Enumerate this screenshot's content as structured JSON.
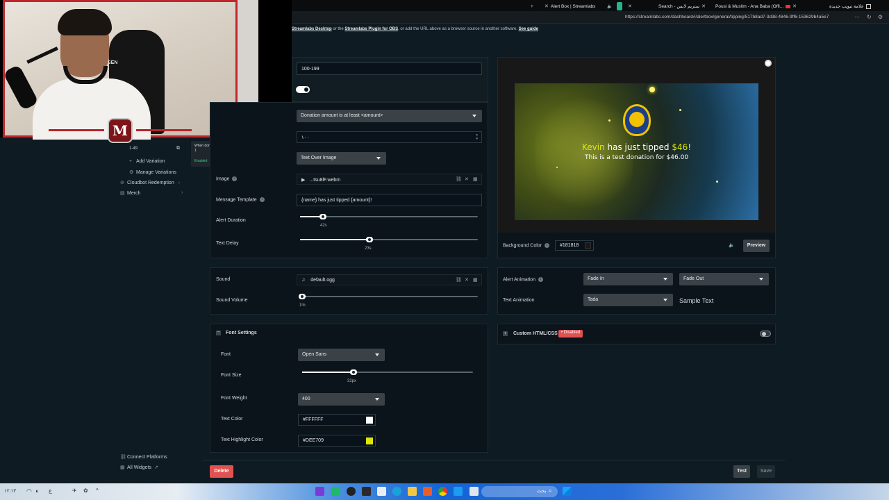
{
  "browser": {
    "tabs": [
      {
        "label": "Alert Box | Streamlabs"
      },
      {
        "label": "Search - ستريم لايس"
      },
      {
        "label": "Pousi & Muslim - Ana Baba (Offi..."
      },
      {
        "label": "علامة تبويب جديدة"
      }
    ],
    "url": "https://streamlabs.com/dashboard#/alertbox/general/tipping/517b8ad7-3d38-4846-9ff6-153629b4a5e7"
  },
  "notice": {
    "link1": "Streamlabs Desktop",
    "text1": " or the ",
    "link2": "Streamlabs Plugin for OBS",
    "text2": ", or add the URL above as a browser source in another software. ",
    "link3": "See guide"
  },
  "webcam": {
    "badge": "M"
  },
  "sidebar": {
    "variation_range": "1-49",
    "tooltip_text": "When donation amount is at least 1",
    "tooltip_status": "Enabled",
    "items": [
      {
        "label": "Add Variation",
        "icon": "plus-icon"
      },
      {
        "label": "Manage Variations",
        "icon": "gear-icon"
      },
      {
        "label": "Cloudbot Redemption",
        "icon": "cloudbot-icon"
      },
      {
        "label": "Merch",
        "icon": "merch-icon"
      }
    ],
    "bottom": [
      {
        "label": "Connect Platforms",
        "icon": "link-icon"
      },
      {
        "label": "All Widgets",
        "icon": "grid-icon"
      }
    ]
  },
  "variation": {
    "name": "100-199",
    "condition": "Donation amount is at least <amount>",
    "amount": "١٠٠",
    "layout": "Text Over Image",
    "image_label": "Image",
    "image_file": "...tsu8lF.webm",
    "message_template_label": "Message Template",
    "message_template": "{name} has just tipped {amount}!",
    "alert_duration_label": "Alert Duration",
    "alert_duration_value": "42s",
    "alert_duration_fraction": 0.13,
    "text_delay_label": "Text Delay",
    "text_delay_value": "23s",
    "text_delay_fraction": 0.39
  },
  "sound": {
    "label": "Sound",
    "file": "default.ogg",
    "volume_label": "Sound Volume",
    "volume_value": "1%",
    "volume_fraction": 0.01
  },
  "font": {
    "header": "Font Settings",
    "font_label": "Font",
    "font_value": "Open Sans",
    "size_label": "Font Size",
    "size_value": "32px",
    "size_fraction": 0.3,
    "weight_label": "Font Weight",
    "weight_value": "400",
    "color_label": "Text Color",
    "color_value": "#FFFFFF",
    "color_swatch": "#FFFFFF",
    "highlight_label": "Text Highlight Color",
    "highlight_value": "#DEE709",
    "highlight_swatch": "#DEE709"
  },
  "preview": {
    "name": "Kevin",
    "middle": " has just tipped ",
    "amount": "$46!",
    "message": "This is a test donation for $46.00",
    "highlight_color": "#DEE709",
    "bg_color_label": "Background Color",
    "bg_color_value": "#181818",
    "preview_button": "Preview"
  },
  "animation": {
    "alert_label": "Alert Animation",
    "alert_in": "Fade In",
    "alert_out": "Fade Out",
    "text_label": "Text Animation",
    "text_value": "Tada",
    "sample_text": "Sample Text"
  },
  "custom_css": {
    "label": "Custom HTML/CSS",
    "status": "Disabled"
  },
  "footer": {
    "delete": "Delete",
    "test": "Test",
    "save": "Save"
  },
  "taskbar": {
    "search_label": "بحث"
  },
  "colors": {
    "accent_red": "#e05252",
    "disabled_badge": "#e05252"
  }
}
